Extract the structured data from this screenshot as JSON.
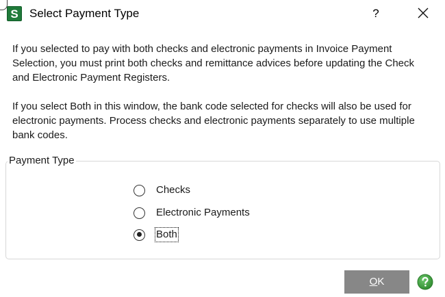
{
  "window": {
    "app_logo_letter": "S",
    "title": "Select Payment Type",
    "help_label": "?",
    "close_icon": "close-icon"
  },
  "content": {
    "paragraph1": "If you selected to pay with both checks and electronic payments in Invoice Payment Selection, you must print both checks and remittance advices before updating the Check and Electronic Payment Registers.",
    "paragraph2": "If you select Both in this window, the bank code selected for checks will also be used for electronic payments. Process checks and electronic payments separately to use multiple bank codes."
  },
  "payment_type": {
    "group_label": "Payment Type",
    "options": [
      {
        "label": "Checks",
        "selected": false
      },
      {
        "label": "Electronic Payments",
        "selected": false
      },
      {
        "label": "Both",
        "selected": true
      }
    ]
  },
  "footer": {
    "ok_mnemonic": "O",
    "ok_rest": "K",
    "help_icon": "help-circle-icon"
  },
  "colors": {
    "logo_green": "#1f7a3a",
    "ok_button_bg": "#878787",
    "help_icon_green": "#3a9a3a"
  }
}
